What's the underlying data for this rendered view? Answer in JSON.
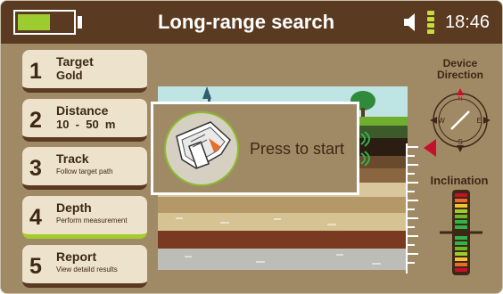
{
  "header": {
    "title": "Long-range search",
    "time": "18:46",
    "battery_level": 0.6,
    "battery_icon": "battery-icon",
    "sound_icon": "speaker-icon",
    "signal_icon": "signal-strength-icon"
  },
  "menu": [
    {
      "number": "1",
      "title": "Target",
      "subtitle": "Gold",
      "active": false
    },
    {
      "number": "2",
      "title": "Distance",
      "subtitle": "10  -  50  m",
      "active": false
    },
    {
      "number": "3",
      "title": "Track",
      "subtitle": "Follow target path",
      "active": false
    },
    {
      "number": "4",
      "title": "Depth",
      "subtitle": "Perform measurement",
      "active": true
    },
    {
      "number": "5",
      "title": "Report",
      "subtitle": "View detaild results",
      "active": false
    }
  ],
  "dialog": {
    "message": "Press to start",
    "device_icon": "detector-device-icon"
  },
  "direction": {
    "label_line1": "Device",
    "label_line2": "Direction",
    "compass": {
      "n": "N",
      "s": "S",
      "e": "E",
      "w": "W"
    }
  },
  "inclination": {
    "label": "Inclination"
  },
  "colors": {
    "background": "#a08a66",
    "header": "#5a3a20",
    "accent": "#9ccc2e",
    "alert": "#c8102e",
    "panel": "#ede3cd"
  }
}
